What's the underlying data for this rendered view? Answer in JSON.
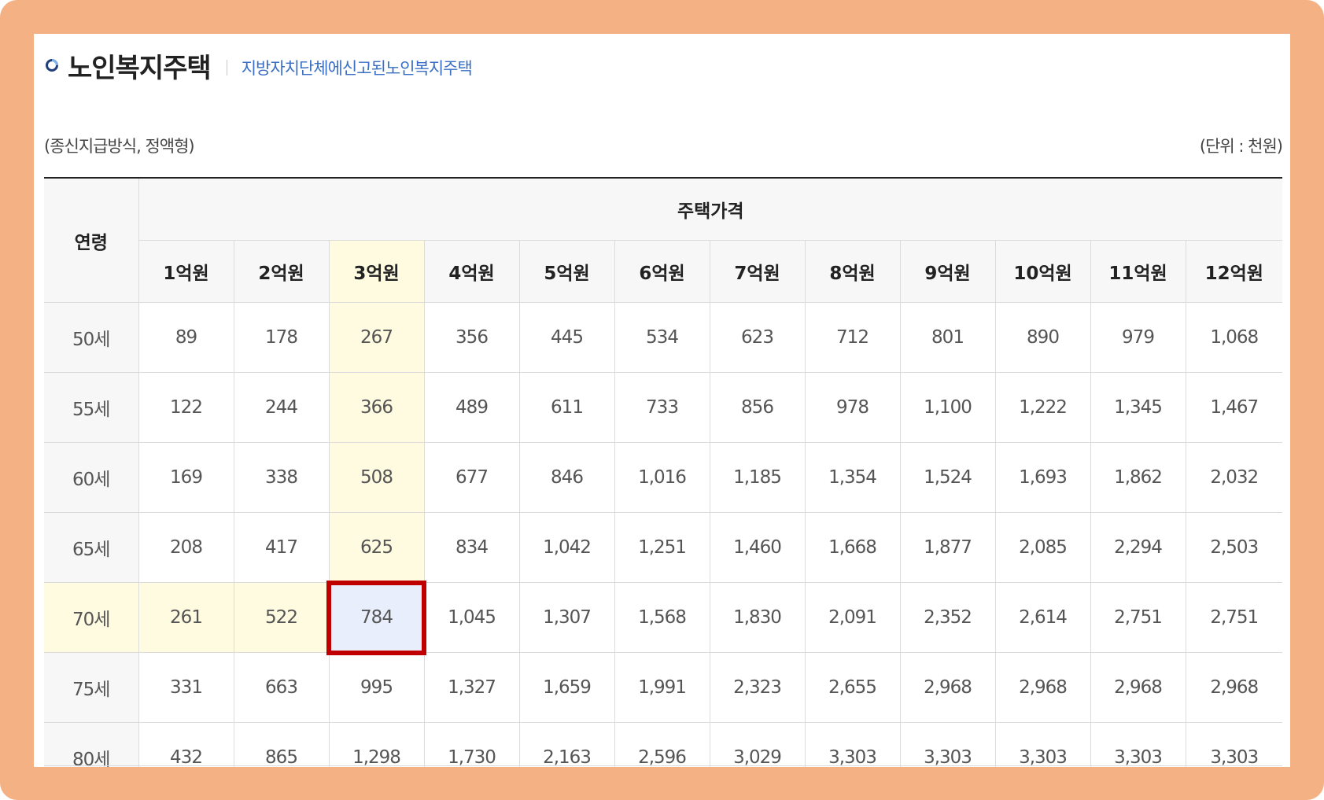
{
  "header": {
    "title": "노인복지주택",
    "subtitle": "지방자치단체에신고된노인복지주택",
    "bullet_icon": "circle-bullet-icon"
  },
  "notes": {
    "left": "(종신지급방식, 정액형)",
    "right": "(단위 : 천원)"
  },
  "table": {
    "age_header": "연령",
    "group_header": "주택가격",
    "columns": [
      "1억원",
      "2억원",
      "3억원",
      "4억원",
      "5억원",
      "6억원",
      "7억원",
      "8억원",
      "9억원",
      "10억원",
      "11억원",
      "12억원"
    ],
    "rows": [
      {
        "age": "50세",
        "values": [
          "89",
          "178",
          "267",
          "356",
          "445",
          "534",
          "623",
          "712",
          "801",
          "890",
          "979",
          "1,068"
        ]
      },
      {
        "age": "55세",
        "values": [
          "122",
          "244",
          "366",
          "489",
          "611",
          "733",
          "856",
          "978",
          "1,100",
          "1,222",
          "1,345",
          "1,467"
        ]
      },
      {
        "age": "60세",
        "values": [
          "169",
          "338",
          "508",
          "677",
          "846",
          "1,016",
          "1,185",
          "1,354",
          "1,524",
          "1,693",
          "1,862",
          "2,032"
        ]
      },
      {
        "age": "65세",
        "values": [
          "208",
          "417",
          "625",
          "834",
          "1,042",
          "1,251",
          "1,460",
          "1,668",
          "1,877",
          "2,085",
          "2,294",
          "2,503"
        ]
      },
      {
        "age": "70세",
        "values": [
          "261",
          "522",
          "784",
          "1,045",
          "1,307",
          "1,568",
          "1,830",
          "2,091",
          "2,352",
          "2,614",
          "2,751",
          "2,751"
        ]
      },
      {
        "age": "75세",
        "values": [
          "331",
          "663",
          "995",
          "1,327",
          "1,659",
          "1,991",
          "2,323",
          "2,655",
          "2,968",
          "2,968",
          "2,968",
          "2,968"
        ]
      },
      {
        "age": "80세",
        "values": [
          "432",
          "865",
          "1,298",
          "1,730",
          "2,163",
          "2,596",
          "3,029",
          "3,303",
          "3,303",
          "3,303",
          "3,303",
          "3,303"
        ]
      }
    ],
    "highlight": {
      "column_index": 2,
      "row_index": 4,
      "column_color": "#fffbe0",
      "selected_color": "#e8eefc",
      "selected_border": "#c00000"
    }
  },
  "colors": {
    "frame": "#f4b183",
    "title_text": "#222222",
    "subtitle_text": "#3a6fc4",
    "header_bg": "#f7f7f7"
  }
}
